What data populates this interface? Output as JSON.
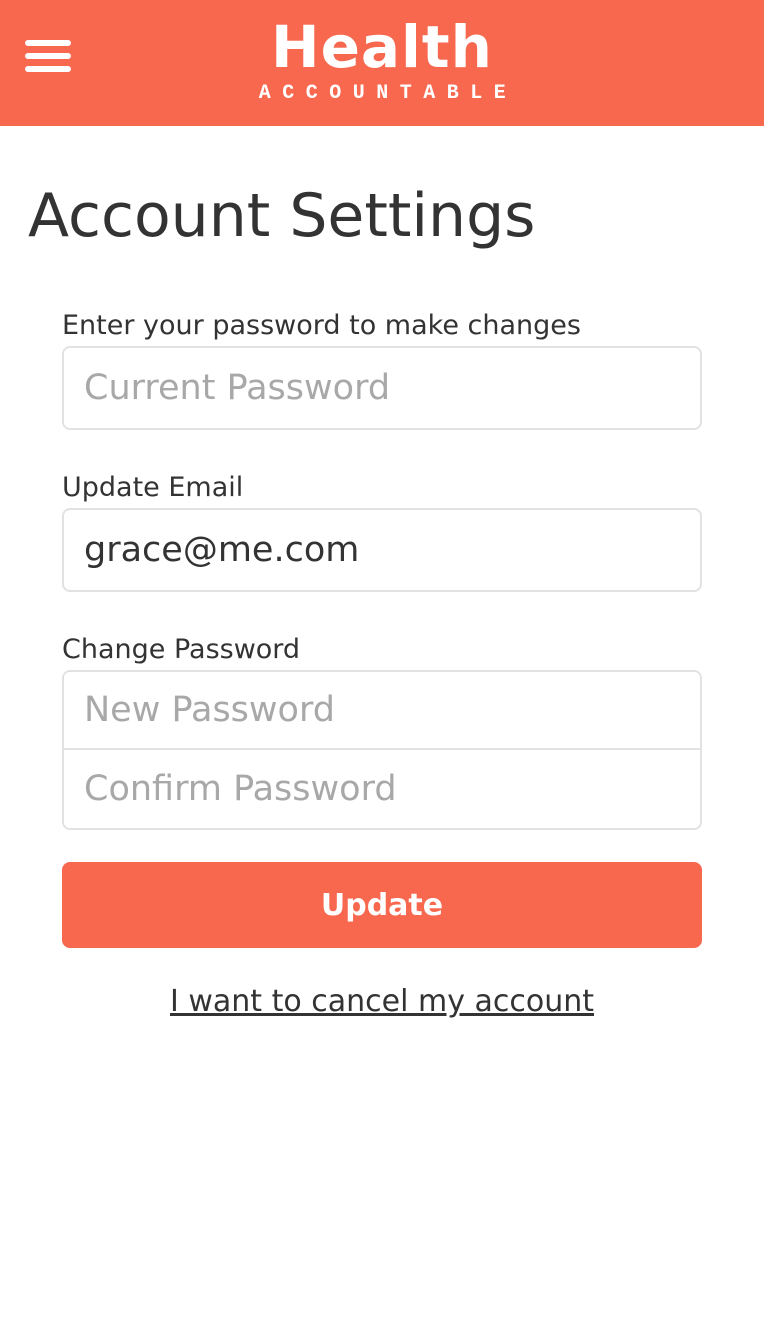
{
  "header": {
    "menu_icon": "hamburger-menu-icon",
    "logo_main": "Health",
    "logo_sub": "ACCOUNTABLE",
    "background_color": "#f7684f"
  },
  "page": {
    "title": "Account Settings"
  },
  "form": {
    "current_password": {
      "label": "Enter your password to make changes",
      "placeholder": "Current Password",
      "value": ""
    },
    "email": {
      "label": "Update Email",
      "placeholder": "",
      "value": "grace@me.com"
    },
    "change_password": {
      "label": "Change Password",
      "new_placeholder": "New Password",
      "confirm_placeholder": "Confirm Password"
    },
    "update_button": "Update",
    "cancel_link": "I want to cancel my account"
  }
}
